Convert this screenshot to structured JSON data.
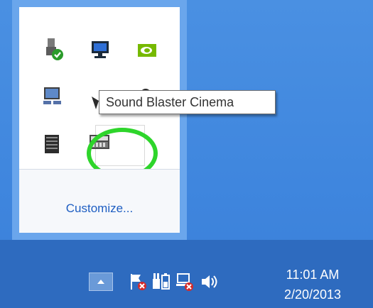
{
  "tooltip": {
    "text": "Sound Blaster Cinema"
  },
  "flyout": {
    "icons": [
      "usb-device-check-icon",
      "display-monitor-icon",
      "nvidia-icon",
      "network-computer-icon",
      "shield-icon",
      "bluetooth-icon",
      "taskmanager-icon",
      "sound-blaster-cinema-icon"
    ],
    "customize_label": "Customize..."
  },
  "taskbar": {
    "tray_icons": [
      "show-hidden-icons-icon",
      "action-center-flag-icon",
      "power-battery-icon",
      "network-error-icon",
      "volume-icon"
    ],
    "time": "11:01 AM",
    "date": "2/20/2013"
  },
  "colors": {
    "desktop": "#4a90e2",
    "taskbar": "#2e6bbf",
    "highlight_ring": "#2ed52b",
    "link": "#1e5ec2"
  }
}
